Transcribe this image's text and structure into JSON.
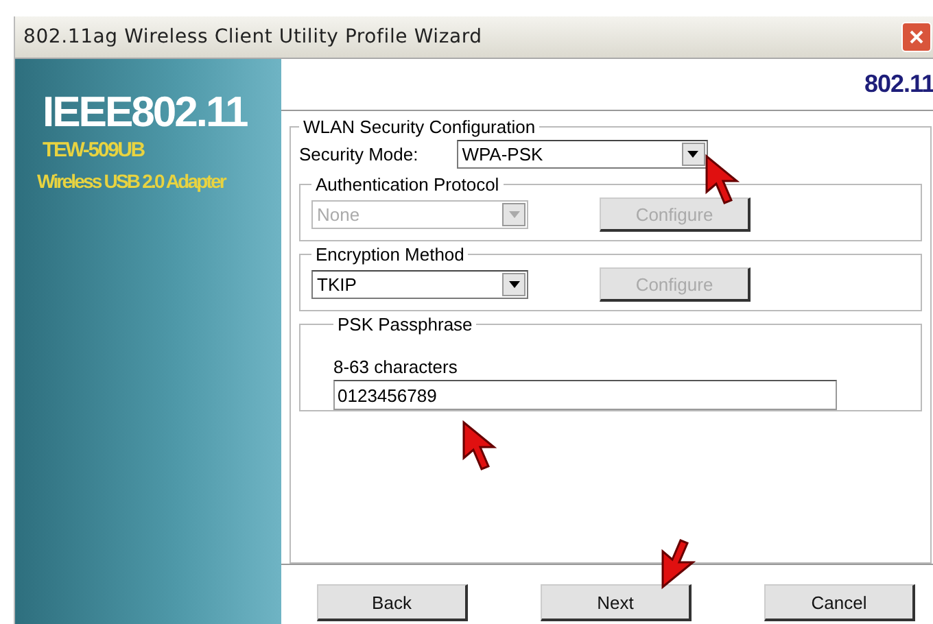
{
  "window": {
    "title": "802.11ag Wireless Client Utility Profile Wizard"
  },
  "banner": {
    "heading": "IEEE802.11",
    "model": "TEW-509UB",
    "product": "Wireless USB 2.0 Adapter"
  },
  "header": {
    "logo": "802.11"
  },
  "security": {
    "title": "WLAN Security Configuration",
    "mode_label": "Security Mode:",
    "mode_value": "WPA-PSK",
    "groups": [
      {
        "title": "Authentication Protocol",
        "value": "None",
        "disabled": true,
        "button": "Configure",
        "button_disabled": true
      },
      {
        "title": "Encryption Method",
        "value": "TKIP",
        "disabled": false,
        "button": "Configure",
        "button_disabled": true
      }
    ],
    "passphrase": {
      "title": "PSK Passphrase",
      "hint": "8-63 characters",
      "value": "0123456789"
    }
  },
  "buttons": [
    "Back",
    "Next",
    "Cancel"
  ]
}
